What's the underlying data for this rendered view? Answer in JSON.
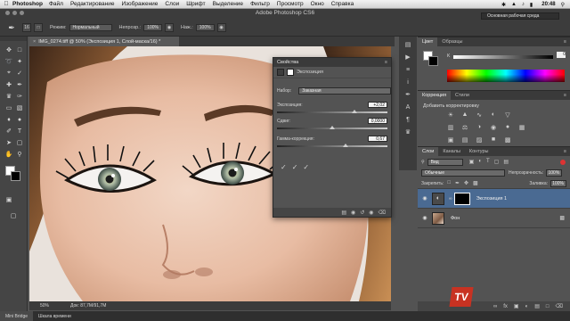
{
  "menubar": {
    "app": "Photoshop",
    "items": [
      "Файл",
      "Редактирование",
      "Изображение",
      "Слои",
      "Шрифт",
      "Выделение",
      "Фильтр",
      "Просмотр",
      "Окно",
      "Справка"
    ],
    "clock": "20:48"
  },
  "options": {
    "window_title": "Adobe Photoshop CS6",
    "brush_size": "16",
    "mode_label": "Режим:",
    "mode_value": "Нормальный",
    "opacity_label": "Непрозр.:",
    "opacity_value": "100%",
    "pressure_label": "Наж.:",
    "pressure_value": "100%",
    "workspace": "Основная рабочая среда"
  },
  "document": {
    "tab_title": "IMG_0274.tiff @ 50% (Экспозиция 1, Слой-маска/16) *",
    "zoom": "50%",
    "doc_info": "Док: 87,7M/91,7M"
  },
  "bottom": {
    "mini_bridge": "Mini Bridge",
    "timeline": "Шкала времени"
  },
  "properties": {
    "title": "Свойства",
    "subtitle": "Экспозиция",
    "preset_label": "Набор:",
    "preset_value": "Заказная",
    "exposure_label": "Экспозиция:",
    "exposure_value": "+2,02",
    "exposure_level": 0.7,
    "offset_label": "Сдвиг:",
    "offset_value": "0,0000",
    "offset_level": 0.5,
    "gamma_label": "Гамма-коррекция:",
    "gamma_value": "0,67",
    "gamma_level": 0.62
  },
  "color_panel": {
    "tabs": [
      "Цвет",
      "Образцы"
    ],
    "channel_label": "K",
    "channel_value": "0"
  },
  "adjustments_panel": {
    "tabs": [
      "Коррекция",
      "Стили"
    ],
    "title": "Добавить корректировку"
  },
  "layers_panel": {
    "tabs": [
      "Слои",
      "Каналы",
      "Контуры"
    ],
    "filter_value": "Вид",
    "blend_value": "Обычные",
    "opacity_label": "Непрозрачность:",
    "opacity_value": "100%",
    "lock_label": "Закрепить:",
    "fill_label": "Заливка:",
    "fill_value": "100%",
    "layers": [
      {
        "name": "Экспозиция 1"
      },
      {
        "name": "Фон"
      }
    ]
  },
  "watermark": {
    "logo": "TV"
  }
}
